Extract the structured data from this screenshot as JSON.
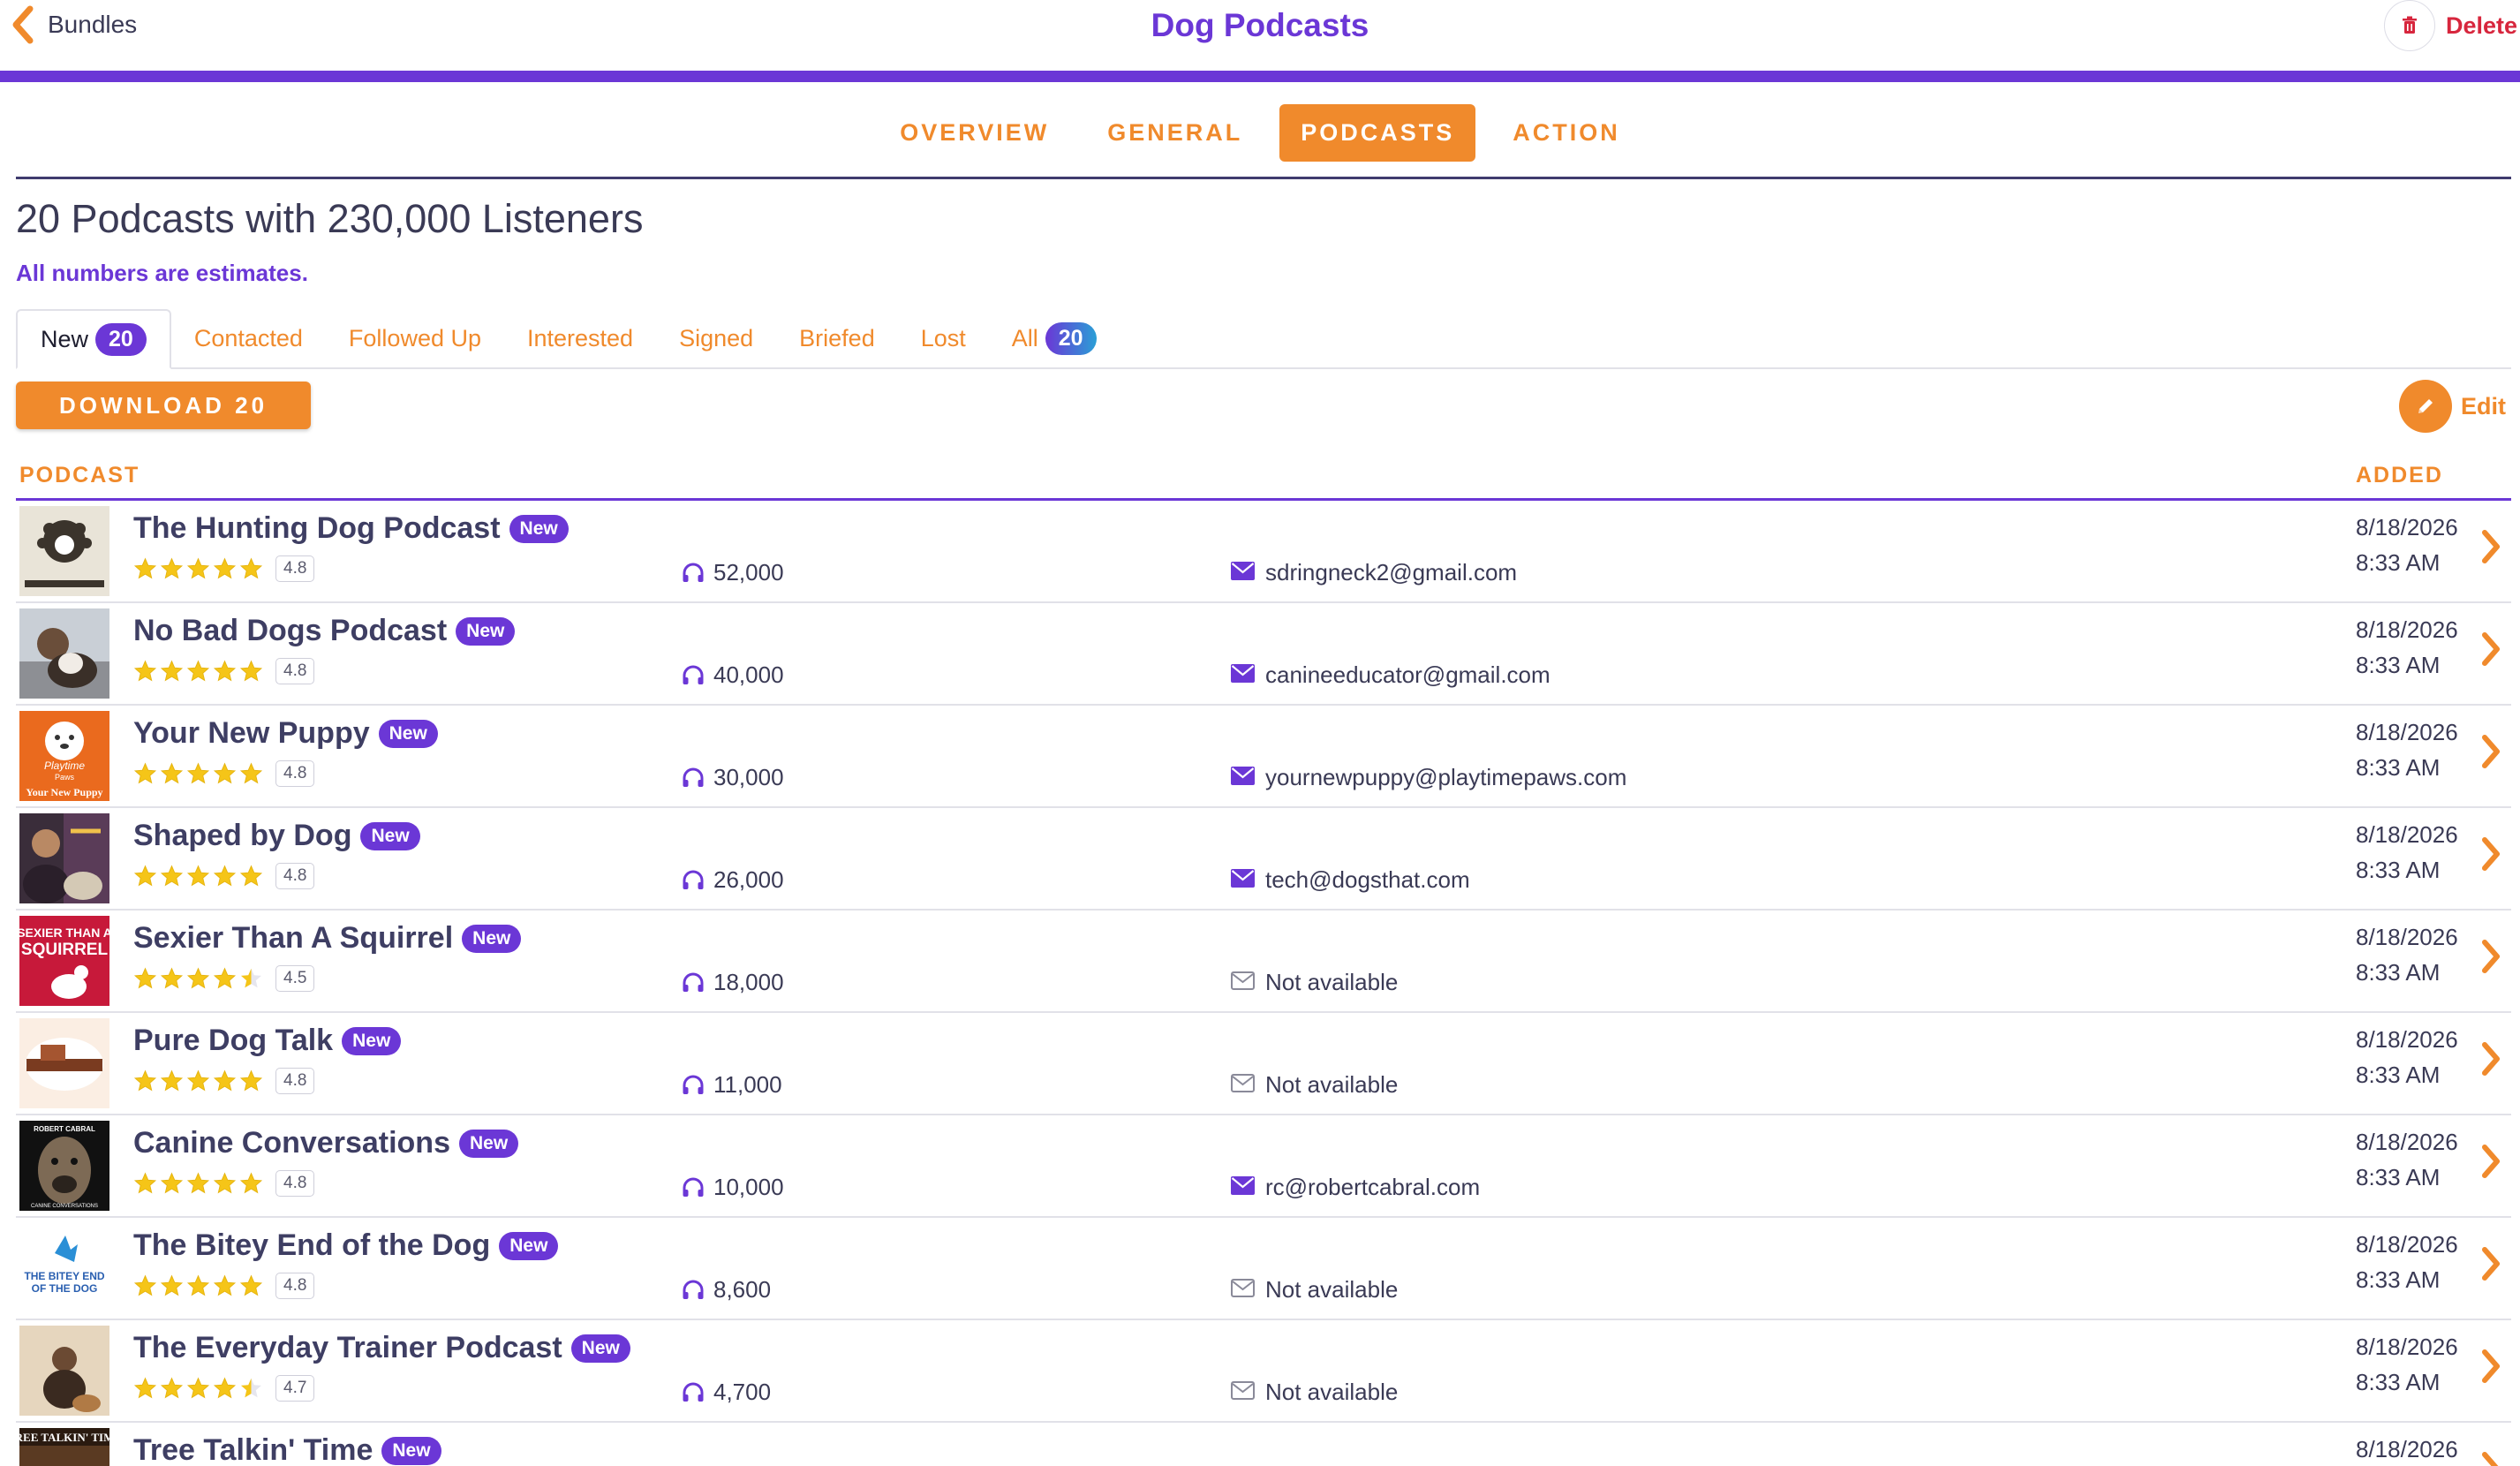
{
  "header": {
    "back_label": "Bundles",
    "title": "Dog Podcasts",
    "delete_label": "Delete"
  },
  "section_tabs": [
    {
      "label": "OVERVIEW",
      "active": false
    },
    {
      "label": "GENERAL",
      "active": false
    },
    {
      "label": "PODCASTS",
      "active": true
    },
    {
      "label": "ACTION",
      "active": false
    }
  ],
  "summary": "20 Podcasts with 230,000 Listeners",
  "estimates_note": "All numbers are estimates.",
  "status_tabs": {
    "new": {
      "label": "New",
      "count": "20"
    },
    "contacted": "Contacted",
    "followed_up": "Followed Up",
    "interested": "Interested",
    "signed": "Signed",
    "briefed": "Briefed",
    "lost": "Lost",
    "all": {
      "label": "All",
      "count": "20"
    }
  },
  "download_label": "DOWNLOAD 20",
  "edit_label": "Edit",
  "columns": {
    "podcast": "PODCAST",
    "added": "ADDED"
  },
  "badge_label": "New",
  "colors": {
    "accent_orange": "#f08a2c",
    "accent_purple": "#6b37d6",
    "delete_red": "#d7263d"
  },
  "rows": [
    {
      "title": "The Hunting Dog Podcast",
      "rating": "4.8",
      "rating_value": 4.8,
      "listeners": "52,000",
      "email": "sdringneck2@gmail.com",
      "email_available": true,
      "added_date": "8/18/2026",
      "added_time": "8:33 AM"
    },
    {
      "title": "No Bad Dogs Podcast",
      "rating": "4.8",
      "rating_value": 4.8,
      "listeners": "40,000",
      "email": "canineeducator@gmail.com",
      "email_available": true,
      "added_date": "8/18/2026",
      "added_time": "8:33 AM"
    },
    {
      "title": "Your New Puppy",
      "rating": "4.8",
      "rating_value": 4.8,
      "listeners": "30,000",
      "email": "yournewpuppy@playtimepaws.com",
      "email_available": true,
      "added_date": "8/18/2026",
      "added_time": "8:33 AM",
      "thumb_text": [
        "Playtime",
        "Paws",
        "Your New Puppy"
      ]
    },
    {
      "title": "Shaped by Dog",
      "rating": "4.8",
      "rating_value": 4.8,
      "listeners": "26,000",
      "email": "tech@dogsthat.com",
      "email_available": true,
      "added_date": "8/18/2026",
      "added_time": "8:33 AM"
    },
    {
      "title": "Sexier Than A Squirrel",
      "rating": "4.5",
      "rating_value": 4.5,
      "listeners": "18,000",
      "email": "Not available",
      "email_available": false,
      "added_date": "8/18/2026",
      "added_time": "8:33 AM",
      "thumb_text": [
        "SEXIER THAN A",
        "SQUIRREL"
      ]
    },
    {
      "title": "Pure Dog Talk",
      "rating": "4.8",
      "rating_value": 4.8,
      "listeners": "11,000",
      "email": "Not available",
      "email_available": false,
      "added_date": "8/18/2026",
      "added_time": "8:33 AM"
    },
    {
      "title": "Canine Conversations",
      "rating": "4.8",
      "rating_value": 4.8,
      "listeners": "10,000",
      "email": "rc@robertcabral.com",
      "email_available": true,
      "added_date": "8/18/2026",
      "added_time": "8:33 AM",
      "thumb_text": [
        "ROBERT CABRAL",
        "CANINE CONVERSATIONS"
      ]
    },
    {
      "title": "The Bitey End of the Dog",
      "rating": "4.8",
      "rating_value": 4.8,
      "listeners": "8,600",
      "email": "Not available",
      "email_available": false,
      "added_date": "8/18/2026",
      "added_time": "8:33 AM",
      "thumb_text": [
        "THE BITEY END",
        "OF THE DOG"
      ]
    },
    {
      "title": "The Everyday Trainer Podcast",
      "rating": "4.7",
      "rating_value": 4.7,
      "listeners": "4,700",
      "email": "Not available",
      "email_available": false,
      "added_date": "8/18/2026",
      "added_time": "8:33 AM"
    },
    {
      "title": "Tree Talkin' Time",
      "rating": "",
      "rating_value": 0,
      "listeners": "",
      "email": "",
      "email_available": true,
      "added_date": "8/18/2026",
      "added_time": "",
      "thumb_text": [
        "TREE TALKIN' TIME"
      ]
    }
  ]
}
